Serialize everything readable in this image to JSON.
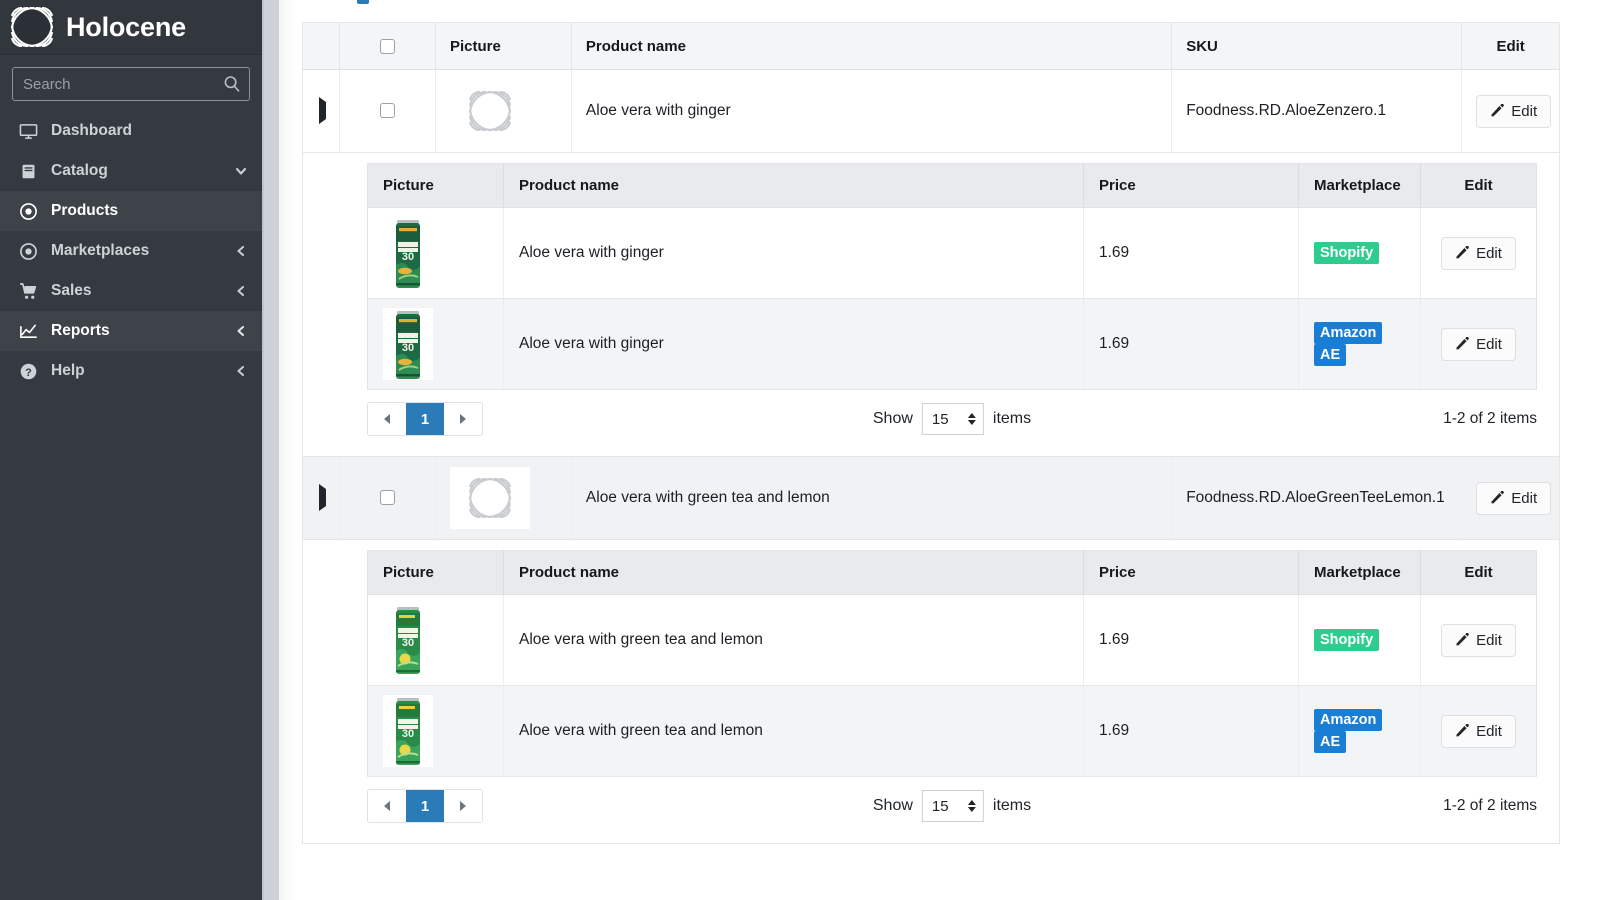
{
  "brand": {
    "name": "Holocene",
    "logo_icon": "holocene-logo-icon"
  },
  "search": {
    "placeholder": "Search",
    "value": "",
    "icon": "search-icon"
  },
  "sidebar": {
    "items": [
      {
        "label": "Dashboard",
        "icon": "monitor-icon",
        "state": "normal",
        "caret": ""
      },
      {
        "label": "Catalog",
        "icon": "book-icon",
        "state": "normal",
        "caret": "chevron-down-icon"
      },
      {
        "label": "Products",
        "icon": "circle-dot-icon",
        "state": "active",
        "caret": ""
      },
      {
        "label": "Marketplaces",
        "icon": "circle-dot-icon",
        "state": "normal",
        "caret": "chevron-left-icon"
      },
      {
        "label": "Sales",
        "icon": "cart-icon",
        "state": "normal",
        "caret": "chevron-left-icon"
      },
      {
        "label": "Reports",
        "icon": "chart-line-icon",
        "state": "highlight",
        "caret": "chevron-left-icon"
      },
      {
        "label": "Help",
        "icon": "question-circle-icon",
        "state": "normal",
        "caret": "chevron-left-icon"
      }
    ]
  },
  "colors": {
    "sidebar_bg": "#343a40",
    "sidebar_active": "#3d4349",
    "accent_blue": "#2b7bb9",
    "badge_shopify": "#2ecc8f",
    "badge_amazon": "#1a7fd4",
    "header_bg": "#f4f5f6",
    "inner_header_bg": "#e8eaeb"
  },
  "outer_table": {
    "headers": [
      "",
      "",
      "Picture",
      "Product name",
      "SKU",
      "Edit"
    ],
    "select_all_checkbox": false,
    "rows": [
      {
        "expanded": true,
        "checked": false,
        "picture": "placeholder-image",
        "product_name": "Aloe vera with ginger",
        "sku": "Foodness.RD.AloeZenzero.1",
        "edit_label": "Edit",
        "shaded": false,
        "nested": {
          "headers": [
            "Picture",
            "Product name",
            "Price",
            "Marketplace",
            "Edit"
          ],
          "rows": [
            {
              "picture": "can-aloe-ginger",
              "product_name": "Aloe vera with ginger",
              "price": "1.69",
              "marketplace": "Shopify",
              "marketplace_type": "shopify",
              "edit_label": "Edit"
            },
            {
              "picture": "can-aloe-ginger",
              "product_name": "Aloe vera with ginger",
              "price": "1.69",
              "marketplace": "Amazon AE",
              "marketplace_type": "amazon",
              "edit_label": "Edit"
            }
          ],
          "pagination": {
            "prev_icon": "chevron-left-icon",
            "next_icon": "chevron-right-icon",
            "current_page": "1",
            "show_label": "Show",
            "page_size": "15",
            "items_label": "items",
            "count_text": "1-2 of 2 items"
          }
        }
      },
      {
        "expanded": true,
        "checked": false,
        "picture": "placeholder-image",
        "product_name": "Aloe vera with green tea and lemon",
        "sku": "Foodness.RD.AloeGreenTeeLemon.1",
        "edit_label": "Edit",
        "shaded": true,
        "nested": {
          "headers": [
            "Picture",
            "Product name",
            "Price",
            "Marketplace",
            "Edit"
          ],
          "rows": [
            {
              "picture": "can-aloe-greentea",
              "product_name": "Aloe vera with green tea and lemon",
              "price": "1.69",
              "marketplace": "Shopify",
              "marketplace_type": "shopify",
              "edit_label": "Edit"
            },
            {
              "picture": "can-aloe-greentea",
              "product_name": "Aloe vera with green tea and lemon",
              "price": "1.69",
              "marketplace": "Amazon AE",
              "marketplace_type": "amazon",
              "edit_label": "Edit"
            }
          ],
          "pagination": {
            "prev_icon": "chevron-left-icon",
            "next_icon": "chevron-right-icon",
            "current_page": "1",
            "show_label": "Show",
            "page_size": "15",
            "items_label": "items",
            "count_text": "1-2 of 2 items"
          }
        }
      }
    ]
  }
}
